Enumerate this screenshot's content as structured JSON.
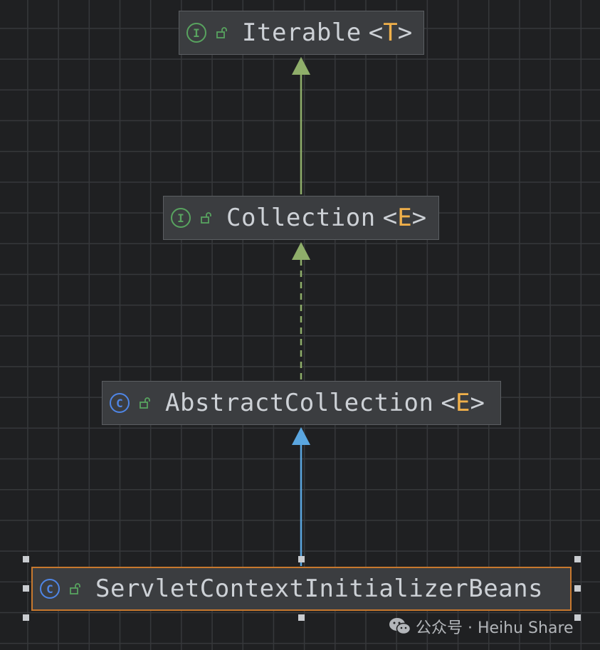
{
  "nodes": {
    "iterable": {
      "kind": "I",
      "name": "Iterable",
      "type_param": "T"
    },
    "collection": {
      "kind": "I",
      "name": "Collection",
      "type_param": "E"
    },
    "abstract_collection": {
      "kind": "C",
      "name": "AbstractCollection",
      "type_param": "E"
    },
    "servlet_beans": {
      "kind": "C",
      "name": "ServletContextInitializerBeans"
    }
  },
  "edges": [
    {
      "from": "collection",
      "to": "iterable",
      "relation": "extends",
      "style": "solid",
      "color": "#8fae6a"
    },
    {
      "from": "abstract_collection",
      "to": "collection",
      "relation": "implements",
      "style": "dashed",
      "color": "#8fae6a"
    },
    {
      "from": "servlet_beans",
      "to": "abstract_collection",
      "relation": "extends",
      "style": "solid",
      "color": "#5aa6e0"
    }
  ],
  "watermark": {
    "text": "公众号 · Heihu Share",
    "icon": "wechat-icon"
  },
  "colors": {
    "interface_icon": "#58a35f",
    "class_icon": "#4f86e6",
    "type_param": "#f0b04a",
    "selection_border": "#c7782e"
  }
}
